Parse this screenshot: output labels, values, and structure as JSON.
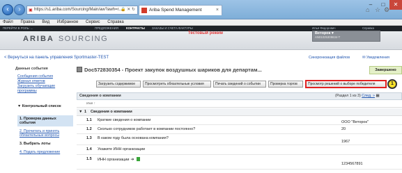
{
  "browser": {
    "url": "https://s1.ariba.com/Sourcing/Main/aw?awh=r...",
    "tab_title": "Ariba Spend Management",
    "menu": [
      "Файл",
      "Правка",
      "Вид",
      "Избранное",
      "Сервис",
      "Справка"
    ]
  },
  "ariba_nav": {
    "items": [
      "ПЕРЕЙТИ В РОЛЬ: ...",
      "ПРЕДЛОЖЕНИЯ",
      "КОНТРАКТЫ",
      "ЗАКАЗЫ И СЧЕТА-ФАКТУРЫ"
    ],
    "user_link": "Илья Федорович",
    "help": "Справка"
  },
  "brand": {
    "name": "ARIBA",
    "product": "SOURCING"
  },
  "test_mode": "Тестовый режим",
  "supplier": {
    "name": "Веторок",
    "code": "AN01025309634-T"
  },
  "back_link": "< Вернуться на панель управления Sportmaster-TEST",
  "sync_files": "Синхронизация файлов",
  "notifications": "Уведомления",
  "sidebar": {
    "title": "Данные события",
    "links": [
      "Сообщения события",
      "Журнал ответов",
      "Загрузить обучающие программы"
    ],
    "checklist_title": "Контрольный список",
    "steps": [
      {
        "label": "1. Проверка данных события"
      },
      {
        "label": "2. Прочитать и принять обязательные вопросы"
      },
      {
        "label": "3. Выбрать лоты"
      },
      {
        "label": "4. Подать предложение"
      }
    ]
  },
  "doc_title": "Doc572830354 - Проект закупок воздушных шариков для департам...",
  "status_tab": "Завершено",
  "buttons": {
    "download": "Загрузить содержимое",
    "view_terms": "Просмотреть обязательные условия",
    "print": "Печать сведений о событии",
    "check_bids": "Проверка торгов",
    "view_winner": "Просмотр решений о выборе победителя"
  },
  "callout_number": "1",
  "section": {
    "title": "Сведения о компании",
    "pager": "(Раздел 1 из 3)",
    "next": "След. »",
    "column": "Имя ↑",
    "group_num": "1",
    "group_title": "Сведения о компании"
  },
  "rows": [
    {
      "num": "1.1",
      "question": "Краткие сведения о компании",
      "answer": "ООО \"Веторок\""
    },
    {
      "num": "1.2",
      "question": "Сколько сотрудников работает в компании постоянно?",
      "answer": "20"
    },
    {
      "num": "1.3",
      "question": "В каком году была основана компания?",
      "answer": "1967"
    },
    {
      "num": "1.4",
      "question": "Укажите ИНН организации",
      "answer": ""
    },
    {
      "num": "1.5",
      "question": "ИНН организации",
      "answer": "1234567891"
    }
  ]
}
